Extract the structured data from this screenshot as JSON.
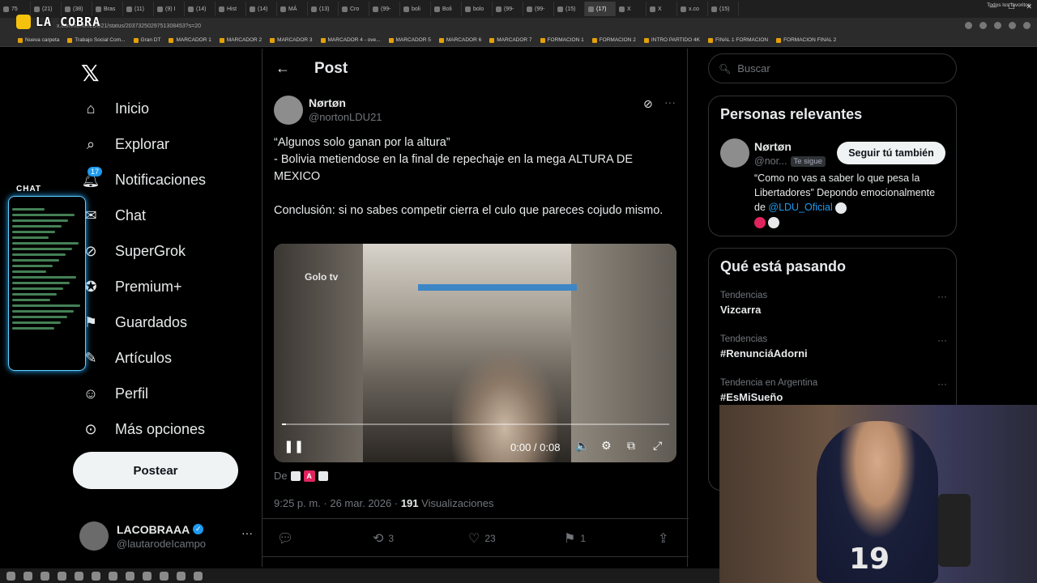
{
  "browser": {
    "tabs": [
      {
        "label": "75",
        "active": false
      },
      {
        "label": "(21)",
        "active": false
      },
      {
        "label": "(38)",
        "active": false
      },
      {
        "label": "Bras",
        "active": false
      },
      {
        "label": "(11)",
        "active": false
      },
      {
        "label": "(9) I",
        "active": false
      },
      {
        "label": "(14)",
        "active": false
      },
      {
        "label": "Hist",
        "active": false
      },
      {
        "label": "(14)",
        "active": false
      },
      {
        "label": "MÁ",
        "active": false
      },
      {
        "label": "(13)",
        "active": false
      },
      {
        "label": "Cro",
        "active": false
      },
      {
        "label": "(99-",
        "active": false
      },
      {
        "label": "boli",
        "active": false
      },
      {
        "label": "Boli",
        "active": false
      },
      {
        "label": "bolo",
        "active": false
      },
      {
        "label": "(99-",
        "active": false
      },
      {
        "label": "(99-",
        "active": false
      },
      {
        "label": "(15)",
        "active": false
      },
      {
        "label": "(17)",
        "active": true
      },
      {
        "label": "X",
        "active": false
      },
      {
        "label": "X",
        "active": false
      },
      {
        "label": "x.co",
        "active": false
      },
      {
        "label": "(15)",
        "active": false
      }
    ],
    "url": "x.com/nortonLDU21/status/2037325029751308453?s=20",
    "bookmarks": [
      "Nueva carpeta",
      "Trabajo Social Com...",
      "Gran DT",
      "MARCADOR 1",
      "MARCADOR 2",
      "MARCADOR 3",
      "MARCADOR 4 - ove...",
      "MARCADOR 5",
      "MARCADOR 6",
      "MARCADOR 7",
      "FORMACION 1",
      "FORMACION 2",
      "INTRO PARTIDO 4K",
      "FINAL 1 FORMACION",
      "FORMACION FINAL 2"
    ],
    "bookmarks_right": "Todos los favoritos"
  },
  "stream": {
    "logo_text": "LA COBRA",
    "chat_title": "CHAT"
  },
  "nav": {
    "items": [
      {
        "label": "Inicio",
        "icon": "home-icon"
      },
      {
        "label": "Explorar",
        "icon": "search-icon"
      },
      {
        "label": "Notificaciones",
        "icon": "bell-icon",
        "badge": "17"
      },
      {
        "label": "Chat",
        "icon": "mail-icon"
      },
      {
        "label": "SuperGrok",
        "icon": "grok-icon"
      },
      {
        "label": "Premium+",
        "icon": "premium-icon"
      },
      {
        "label": "Guardados",
        "icon": "bookmark-icon"
      },
      {
        "label": "Artículos",
        "icon": "articles-icon"
      },
      {
        "label": "Perfil",
        "icon": "person-icon"
      },
      {
        "label": "Más opciones",
        "icon": "more-icon"
      }
    ],
    "post_button": "Postear",
    "account": {
      "name": "LACOBRAAA",
      "handle": "@lautarodeIcampo",
      "more": "···"
    }
  },
  "main": {
    "back": "←",
    "title": "Post",
    "author": {
      "name": "Nørtøn",
      "handle": "@nortonLDU21"
    },
    "text": {
      "line1": "“Algunos solo ganan por la altura”",
      "line2": "- Bolivia metiendose en la final de repechaje en la mega ALTURA DE MEXICO",
      "line3": "Conclusión: si no sabes competir cierra el culo que pareces cojudo mismo."
    },
    "media": {
      "watermark": "Golo tv",
      "time": "0:00 / 0:08",
      "progress": 0.01
    },
    "from_prefix": "De",
    "from_letter": "A",
    "meta": {
      "time_date": "9:25 p. m. · 26 mar. 2026 · ",
      "views_count": "191",
      "views_label": " Visualizaciones"
    },
    "actions": {
      "replies": "",
      "reposts": "3",
      "likes": "23",
      "bookmarks": "1"
    }
  },
  "right": {
    "search_placeholder": "Buscar",
    "relevant": {
      "title": "Personas relevantes",
      "name": "Nørtøn",
      "handle": "@nor...",
      "follows_you": "Te sigue",
      "follow_button": "Seguir tú también",
      "bio_text": "“Como no vas a saber lo que pesa la Libertadores” Depondo emocionalmente de ",
      "bio_mention": "@LDU_Oficial"
    },
    "trending": {
      "title": "Qué está pasando",
      "items": [
        {
          "category": "Tendencias",
          "topic": "Vizcarra"
        },
        {
          "category": "Tendencias",
          "topic": "#RenunciáAdorni"
        },
        {
          "category": "Tendencia en Argentina",
          "topic": "#EsMiSueño"
        }
      ]
    }
  },
  "webcam": {
    "jersey_number": "19"
  }
}
